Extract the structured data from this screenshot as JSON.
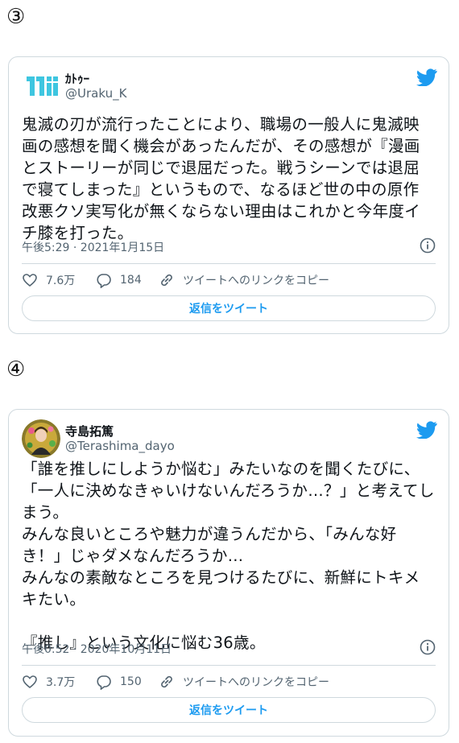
{
  "tweets": [
    {
      "marker": "③",
      "name": "ｶﾄｩｰ",
      "handle": "@Uraku_K",
      "text": "鬼滅の刃が流行ったことにより、職場の一般人に鬼滅映\n画の感想を聞く機会があったんだが、その感想が『漫画\nとストーリーが同じで退屈だった。戦うシーンでは退屈\nで寝てしまった』というもので、なるほど世の中の原作\n改悪クソ実写化が無くならない理由はこれかと今年度イ\nチ膝を打った。",
      "timestamp": "午後5:29 · 2021年1月15日",
      "likes": "7.6万",
      "replies": "184",
      "copy_link": "ツイートへのリンクをコピー",
      "reply_button": "返信をツイート"
    },
    {
      "marker": "④",
      "name": "寺島拓篤",
      "handle": "@Terashima_dayo",
      "text": "「誰を推しにしようか悩む」みたいなのを聞くたびに、\n「一人に決めなきゃいけないんだろうか…？」と考えてし\nまう。\nみんな良いところや魅力が違うんだから、「みんな好\nき！」じゃダメなんだろうか…\nみんなの素敵なところを見つけるたびに、新鮮にトキメ\nキたい。\n\n『推し』という文化に悩む36歳。",
      "timestamp": "午後0:52 · 2020年10月11日",
      "likes": "3.7万",
      "replies": "150",
      "copy_link": "ツイートへのリンクをコピー",
      "reply_button": "返信をツイート"
    }
  ],
  "colors": {
    "accent": "#1d9bf0",
    "text": "#0f1419",
    "muted": "#536471",
    "border": "#cfd9de",
    "logo_cyan": "#3ec6e0"
  },
  "icons": [
    "twitter-bird-icon",
    "info-icon",
    "heart-icon",
    "reply-icon",
    "link-icon"
  ]
}
